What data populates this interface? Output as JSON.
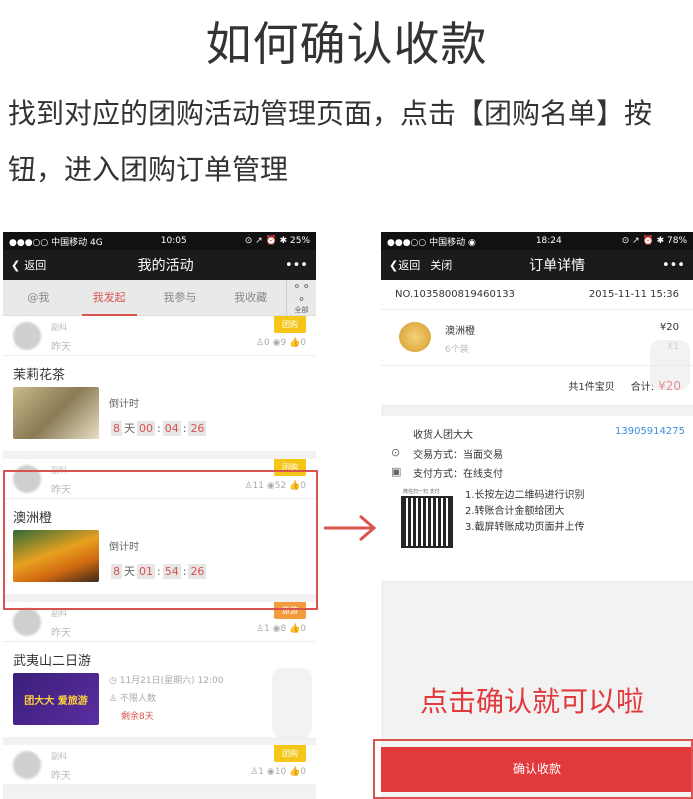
{
  "header": {
    "title": "如何确认收款",
    "intro": "找到对应的团购活动管理页面，点击【团购名单】按钮，进入团购订单管理"
  },
  "phone1": {
    "status": {
      "left": "●●●○○ 中国移动  4G",
      "time": "10:05",
      "right": "⊙ ↗ ⏰ ✱ 25%"
    },
    "nav": {
      "back": "返回",
      "title": "我的活动",
      "more": "•••"
    },
    "tabs": [
      "@我",
      "我发起",
      "我参与",
      "我收藏"
    ],
    "all_label": "全部",
    "cards": [
      {
        "user": "副科",
        "date": "昨天",
        "tag": "团购",
        "tag_color": "#f5c518",
        "stats": "♙0 ◉9 👍0",
        "name": "茉莉花茶",
        "countdown_label": "倒计时",
        "days": "8",
        "h": "00",
        "m": "04",
        "s": "26"
      },
      {
        "user": "副科",
        "date": "昨天",
        "tag": "团购",
        "tag_color": "#f5c518",
        "stats": "♙11 ◉52 👍0",
        "name": "澳洲橙",
        "countdown_label": "倒计时",
        "days": "8",
        "h": "01",
        "m": "54",
        "s": "26"
      },
      {
        "user": "副科",
        "date": "昨天",
        "tag": "旅游",
        "tag_color": "#f39c3d",
        "stats": "♙1 ◉8 👍0",
        "name": "武夷山二日游",
        "time": "11月21日(星期六) 12:00",
        "limit": "不限人数",
        "remain": "剩余8天"
      },
      {
        "user": "副科",
        "date": "昨天",
        "tag": "团购",
        "tag_color": "#f5c518",
        "stats": "♙1 ◉10 👍0"
      }
    ],
    "day_unit": "天",
    "travel_thumb_text": "团大大 爱旅游"
  },
  "phone2": {
    "status": {
      "left": "●●●○○ 中国移动 ◉",
      "time": "18:24",
      "right": "⊙ ↗ ⏰ ✱ 78%"
    },
    "nav": {
      "back": "返回",
      "close": "关闭",
      "title": "订单详情",
      "more": "•••"
    },
    "order_no": "NO.1035800819460133",
    "order_date": "2015-11-11 15:36",
    "item_name": "澳洲橙",
    "item_spec": "6个装",
    "item_price": "¥20",
    "item_qty": "X1",
    "total_label": "共1件宝贝",
    "total_sum_label": "合计:",
    "total_sum": "¥20",
    "receiver_label": "收货人团大大",
    "receiver_phone": "13905914275",
    "trade_label": "交易方式：当面交易",
    "pay_label": "支付方式：在线支付",
    "steps": [
      "1.长按左边二维码进行识别",
      "2.转账合计金额给团大",
      "3.截屏转账成功页面并上传"
    ],
    "confirm_button": "确认收款",
    "qr_caption": "微信扫一扫 支付"
  },
  "hint_text": "点击确认就可以啦",
  "colors": {
    "accent": "#e2393c",
    "tag_yellow": "#f5c518",
    "tag_orange": "#f39c3d",
    "blue": "#3c8dde"
  }
}
